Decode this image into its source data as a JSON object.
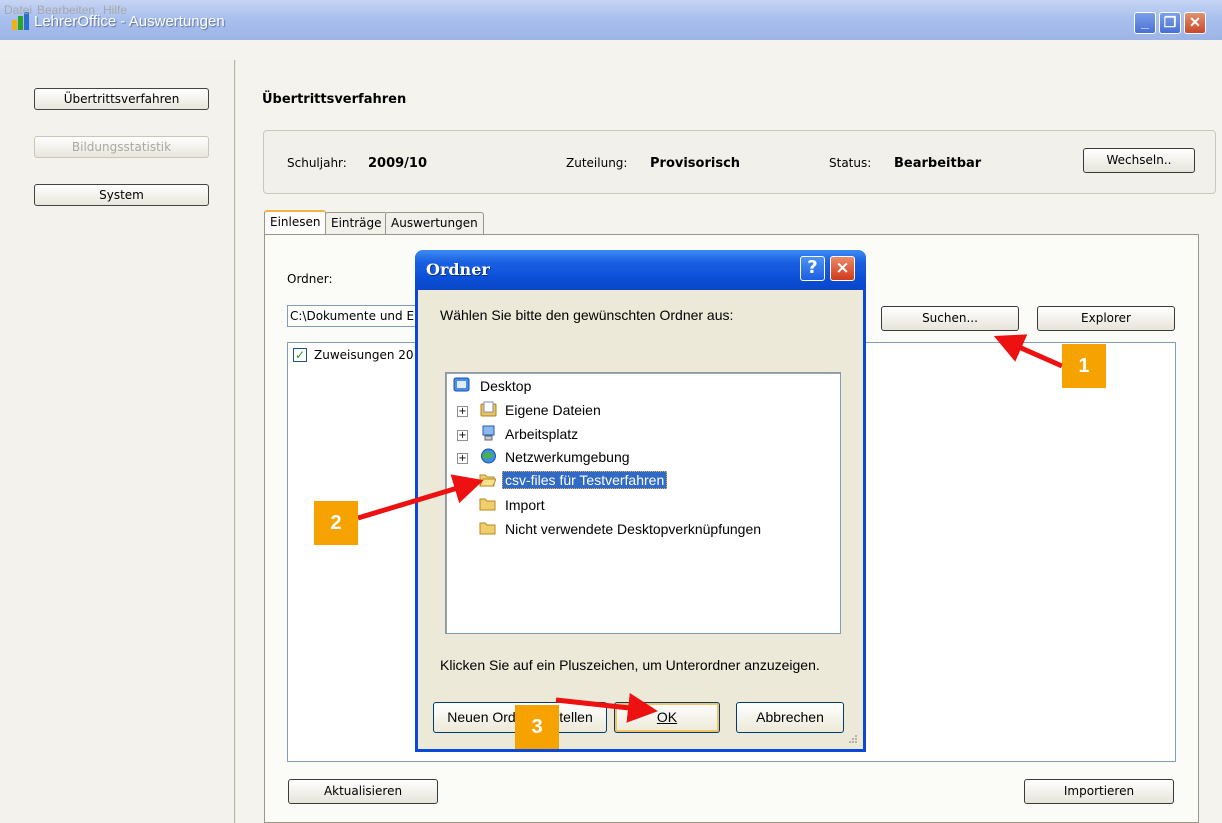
{
  "window": {
    "title": "LehrerOffice - Auswertungen"
  },
  "menu": {
    "items": [
      "Datei",
      "Bearbeiten",
      "Hilfe"
    ]
  },
  "nav": {
    "items": [
      {
        "label": "Übertrittsverfahren",
        "enabled": true
      },
      {
        "label": "Bildungsstatistik",
        "enabled": false
      },
      {
        "label": "System",
        "enabled": true
      }
    ]
  },
  "main": {
    "title": "Übertrittsverfahren",
    "info": {
      "schuljahr_label": "Schuljahr:",
      "schuljahr_value": "2009/10",
      "zuteilung_label": "Zuteilung:",
      "zuteilung_value": "Provisorisch",
      "status_label": "Status:",
      "status_value": "Bearbeitbar",
      "change_button": "Wechseln.."
    },
    "tabs": [
      "Einlesen",
      "Einträge",
      "Auswertungen"
    ],
    "active_tab": "Einlesen",
    "folder_label": "Ordner:",
    "folder_value": "C:\\Dokumente und Ein",
    "search_button": "Suchen...",
    "explorer_button": "Explorer",
    "file_item": {
      "label": "Zuweisungen 200",
      "checked": true
    },
    "refresh_button": "Aktualisieren",
    "import_button": "Importieren"
  },
  "dialog": {
    "title": "Ordner",
    "help_glyph": "?",
    "close_glyph": "×",
    "prompt": "Wählen Sie bitte den gewünschten Ordner aus:",
    "tree": [
      {
        "label": "Desktop",
        "icon": "desktop-icon",
        "expander": false,
        "indent": 0
      },
      {
        "label": "Eigene Dateien",
        "icon": "my-documents-icon",
        "expander": true,
        "indent": 1
      },
      {
        "label": "Arbeitsplatz",
        "icon": "my-computer-icon",
        "expander": true,
        "indent": 1
      },
      {
        "label": "Netzwerkumgebung",
        "icon": "network-icon",
        "expander": true,
        "indent": 1
      },
      {
        "label": "csv-files für Testverfahren",
        "icon": "folder-open-icon",
        "expander": false,
        "indent": 1,
        "selected": true
      },
      {
        "label": "Import",
        "icon": "folder-icon",
        "expander": false,
        "indent": 1
      },
      {
        "label": "Nicht verwendete Desktopverknüpfungen",
        "icon": "folder-icon",
        "expander": false,
        "indent": 1
      }
    ],
    "hint": "Klicken Sie auf ein Pluszeichen, um Unterordner anzuzeigen.",
    "new_folder_button": "Neuen Ordner erstellen",
    "ok_button": "OK",
    "cancel_button": "Abbrechen"
  },
  "annotations": [
    {
      "number": "1",
      "target": "Suchen..."
    },
    {
      "number": "2",
      "target": "csv-files für Testverfahren"
    },
    {
      "number": "3",
      "target": "OK"
    }
  ],
  "colors": {
    "accent": "#0a48d8",
    "selection": "#316ac5",
    "marker": "#f6a200",
    "arrow": "#ee1111"
  }
}
